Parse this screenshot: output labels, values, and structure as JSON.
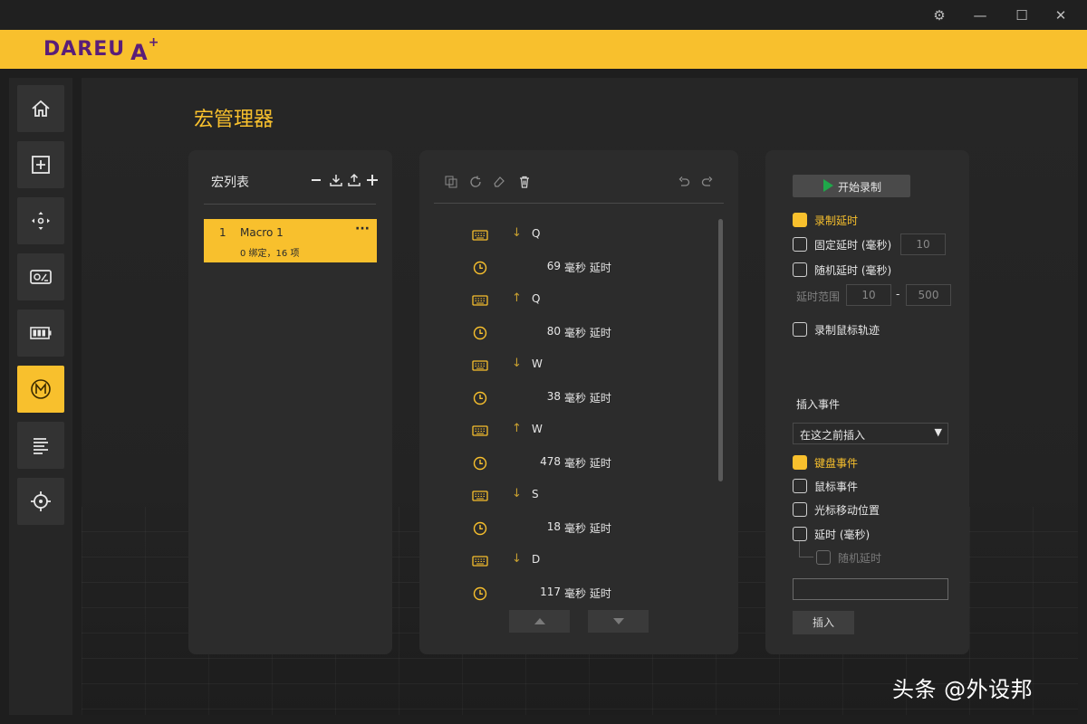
{
  "brand": {
    "logo_text": "DAREU",
    "logo_mark": "A",
    "logo_sup": "+"
  },
  "window": {
    "settings_icon": "⚙",
    "minimize_icon": "—",
    "maximize_icon": "☐",
    "close_icon": "✕"
  },
  "sidebar": {
    "items": [
      {
        "icon": "home-icon",
        "active": false
      },
      {
        "icon": "plus-box-icon",
        "active": false
      },
      {
        "icon": "dpi-icon",
        "active": false
      },
      {
        "icon": "sensor-icon",
        "active": false
      },
      {
        "icon": "battery-icon",
        "active": false
      },
      {
        "icon": "macro-icon",
        "active": true,
        "label": "M"
      },
      {
        "icon": "text-lines-icon",
        "active": false
      },
      {
        "icon": "crosshair-icon",
        "active": false
      }
    ]
  },
  "page": {
    "title": "宏管理器"
  },
  "macro_list": {
    "title": "宏列表",
    "items": [
      {
        "index": "1",
        "name": "Macro 1",
        "summary": "0 绑定，16 项",
        "more": "···"
      }
    ]
  },
  "events": {
    "rows": [
      {
        "type": "key",
        "arrow": "↓",
        "key": "Q"
      },
      {
        "type": "delay",
        "value": "69",
        "unit": "毫秒 延时"
      },
      {
        "type": "key",
        "arrow": "↑",
        "key": "Q"
      },
      {
        "type": "delay",
        "value": "80",
        "unit": "毫秒 延时"
      },
      {
        "type": "key",
        "arrow": "↓",
        "key": "W"
      },
      {
        "type": "delay",
        "value": "38",
        "unit": "毫秒 延时"
      },
      {
        "type": "key",
        "arrow": "↑",
        "key": "W"
      },
      {
        "type": "delay",
        "value": "478",
        "unit": "毫秒 延时"
      },
      {
        "type": "key",
        "arrow": "↓",
        "key": "S"
      },
      {
        "type": "delay",
        "value": "18",
        "unit": "毫秒 延时"
      },
      {
        "type": "key",
        "arrow": "↓",
        "key": "D"
      },
      {
        "type": "delay",
        "value": "117",
        "unit": "毫秒 延时"
      }
    ]
  },
  "recording": {
    "start_label": "开始录制",
    "record_delay": "录制延时",
    "fixed_delay": "固定延时 (毫秒)",
    "fixed_delay_value": "10",
    "random_delay": "随机延时 (毫秒)",
    "delay_range_label": "延时范围",
    "range_min": "10",
    "range_sep": "-",
    "range_max": "500",
    "record_mouse": "录制鼠标轨迹",
    "insert_event_label": "插入事件",
    "insert_position": "在这之前插入",
    "insert_caret": "▼",
    "keyboard_event": "键盘事件",
    "mouse_event": "鼠标事件",
    "cursor_move": "光标移动位置",
    "delay_ms": "延时 (毫秒)",
    "random_delay_sub": "随机延时",
    "insert_button": "插入"
  },
  "colors": {
    "accent": "#f8c02d",
    "panel": "#2c2c2c",
    "brand_text": "#5a1e78",
    "play": "#1fa84a"
  },
  "watermark": "头条 @外设邦"
}
